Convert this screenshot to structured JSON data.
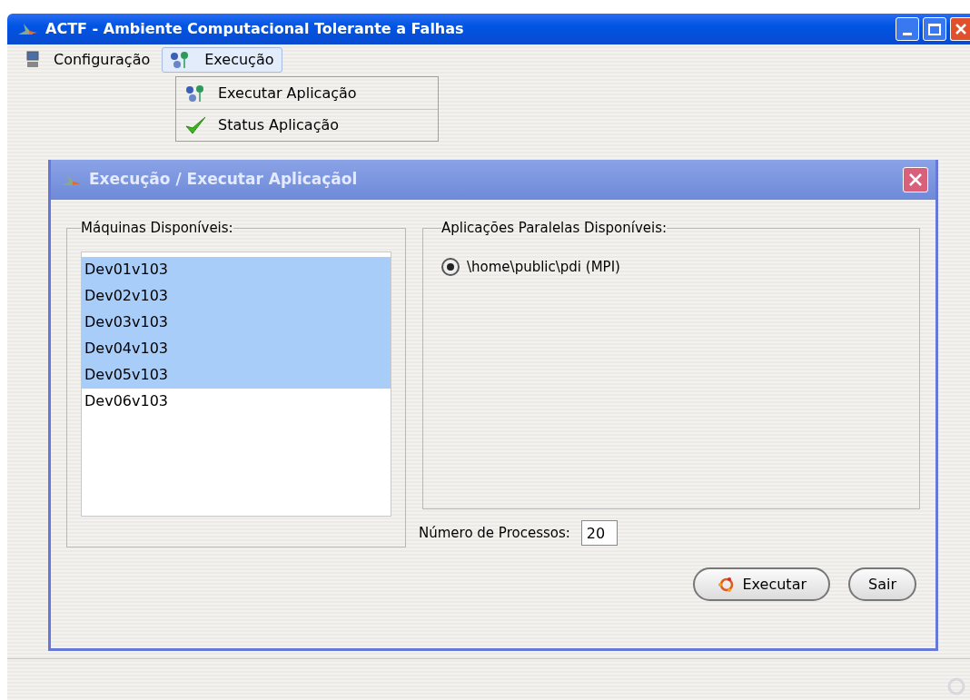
{
  "window": {
    "title": "ACTF - Ambiente Computacional Tolerante a Falhas"
  },
  "menubar": [
    {
      "label": "Configuração",
      "kind": "monitor",
      "open": false
    },
    {
      "label": "Execução",
      "kind": "network",
      "open": true
    }
  ],
  "dropdown": [
    {
      "label": "Executar Aplicação",
      "kind": "network"
    },
    {
      "label": "Status Aplicação",
      "kind": "check"
    }
  ],
  "dialog": {
    "title": "Execução / Executar Aplicaçãol",
    "machines": {
      "label": "Máquinas Disponíveis:",
      "items": [
        {
          "name": "Dev01v103",
          "selected": true
        },
        {
          "name": "Dev02v103",
          "selected": true
        },
        {
          "name": "Dev03v103",
          "selected": true
        },
        {
          "name": "Dev04v103",
          "selected": true
        },
        {
          "name": "Dev05v103",
          "selected": true
        },
        {
          "name": "Dev06v103",
          "selected": false
        }
      ]
    },
    "applications": {
      "label": "Aplicações Paralelas Disponíveis:",
      "items": [
        {
          "name": "\\home\\public\\pdi (MPI)",
          "selected": true
        }
      ]
    },
    "processes": {
      "label": "Número de Processos:",
      "value": "20"
    },
    "buttons": [
      {
        "label": "Executar",
        "kind": "run"
      },
      {
        "label": "Sair",
        "kind": "plain"
      }
    ]
  }
}
